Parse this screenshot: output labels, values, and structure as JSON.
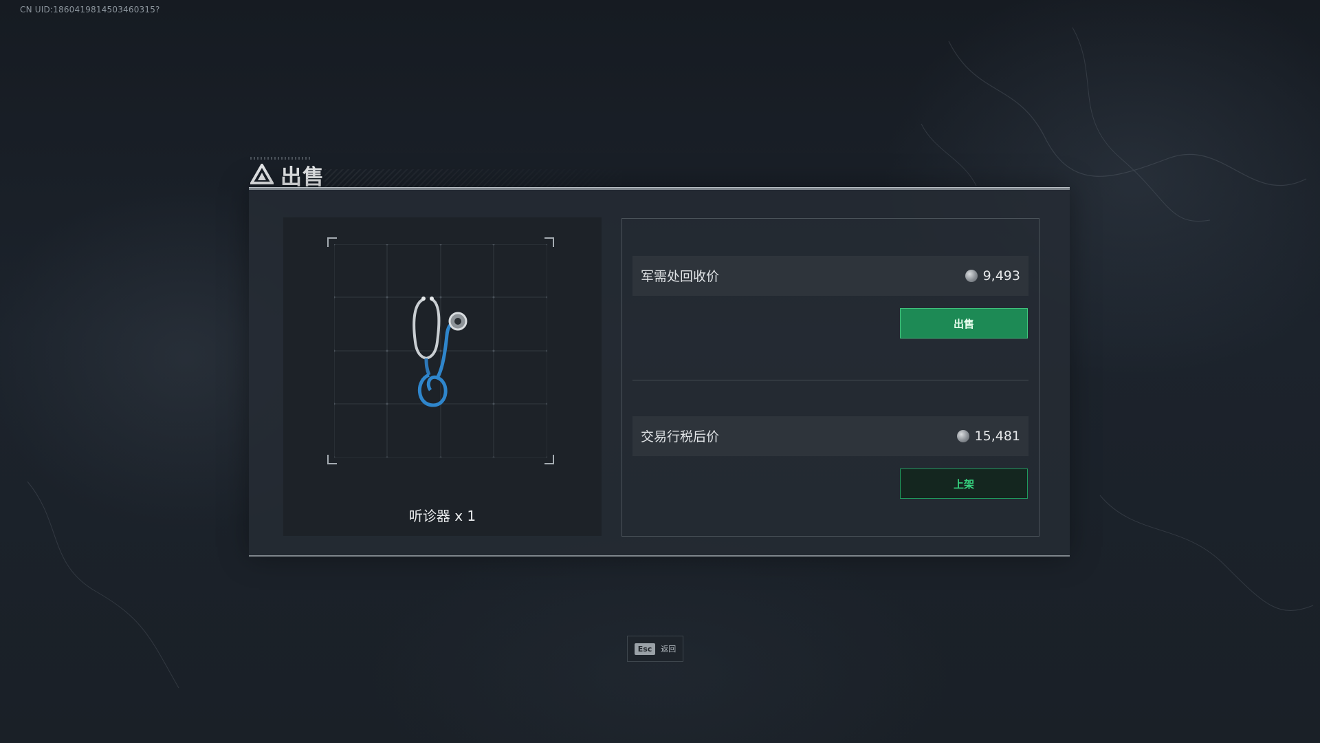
{
  "uid": "CN UID:1860419814503460315?",
  "dialog": {
    "title": "出售",
    "item": {
      "name": "听诊器 x 1",
      "icon": "stethoscope-icon"
    },
    "recycle": {
      "label": "军需处回收价",
      "price": "9,493",
      "button": "出售"
    },
    "market": {
      "label": "交易行税后价",
      "price": "15,481",
      "button": "上架"
    }
  },
  "footer": {
    "key": "Esc",
    "text": "返回"
  },
  "colors": {
    "sell_button": "#1d8a55",
    "list_button_text": "#36d37f",
    "panel": "#262c34"
  }
}
